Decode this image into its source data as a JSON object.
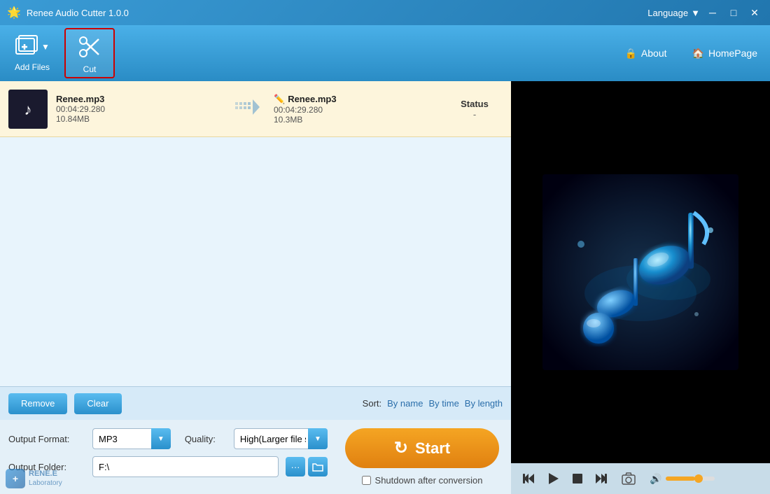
{
  "app": {
    "title": "Renee Audio Cutter 1.0.0",
    "logo": "🎵"
  },
  "titlebar": {
    "language_label": "Language",
    "dropdown_arrow": "▼",
    "minimize": "─",
    "maximize": "□",
    "close": "✕"
  },
  "toolbar": {
    "add_files_label": "Add Files",
    "cut_label": "Cut",
    "about_label": "About",
    "homepage_label": "HomePage"
  },
  "file_list": {
    "items": [
      {
        "thumbnail_icon": "♪",
        "input_filename": "Renee.mp3",
        "input_duration": "00:04:29.280",
        "input_size": "10.84MB",
        "output_filename": "Renee.mp3",
        "output_duration": "00:04:29.280",
        "output_size": "10.3MB",
        "status_label": "Status",
        "status_value": "-"
      }
    ]
  },
  "bottom_controls": {
    "remove_label": "Remove",
    "clear_label": "Clear",
    "sort_label": "Sort:",
    "sort_by_name": "By name",
    "sort_by_time": "By time",
    "sort_by_length": "By length"
  },
  "player": {
    "skip_back": "⏮",
    "play": "▶",
    "stop": "■",
    "skip_forward": "⏭",
    "screenshot": "📷",
    "volume_icon": "🔊",
    "volume_percent": 60
  },
  "settings": {
    "output_format_label": "Output Format:",
    "output_format_value": "MP3",
    "quality_label": "Quality:",
    "quality_value": "High(Larger file size)",
    "output_folder_label": "Output Folder:",
    "output_folder_value": "F:\\"
  },
  "start": {
    "label": "Start",
    "shutdown_label": "Shutdown after conversion"
  },
  "brand": {
    "name": "RENE.E\nLaboratory"
  }
}
